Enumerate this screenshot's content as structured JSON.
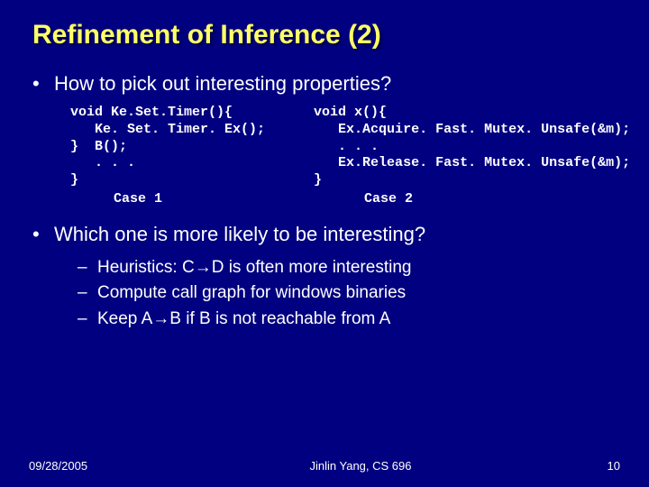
{
  "title": "Refinement of Inference (2)",
  "q1": "How to pick out interesting properties?",
  "code1_l1": "void Ke.Set.Timer(){",
  "code1_l2": "   Ke. Set. Timer. Ex();",
  "code1_l3": "}  B();",
  "code1_l4": "   . . .",
  "code1_l5": "}",
  "case1": "Case 1",
  "code2_l1": "void x(){",
  "code2_l2": "   Ex.Acquire. Fast. Mutex. Unsafe(&m);",
  "code2_l3": "   . . .",
  "code2_l4": "   Ex.Release. Fast. Mutex. Unsafe(&m);",
  "code2_l5": "}",
  "case2": "Case 2",
  "q2": "Which one is more likely to be interesting?",
  "h1_a": "Heuristics: C",
  "h1_b": "D is often more interesting",
  "h2": "Compute call graph for windows binaries",
  "h3_a": "Keep A",
  "h3_b": "B if B is not reachable from A",
  "footer_date": "09/28/2005",
  "footer_center": "Jinlin Yang, CS 696",
  "footer_page": "10"
}
